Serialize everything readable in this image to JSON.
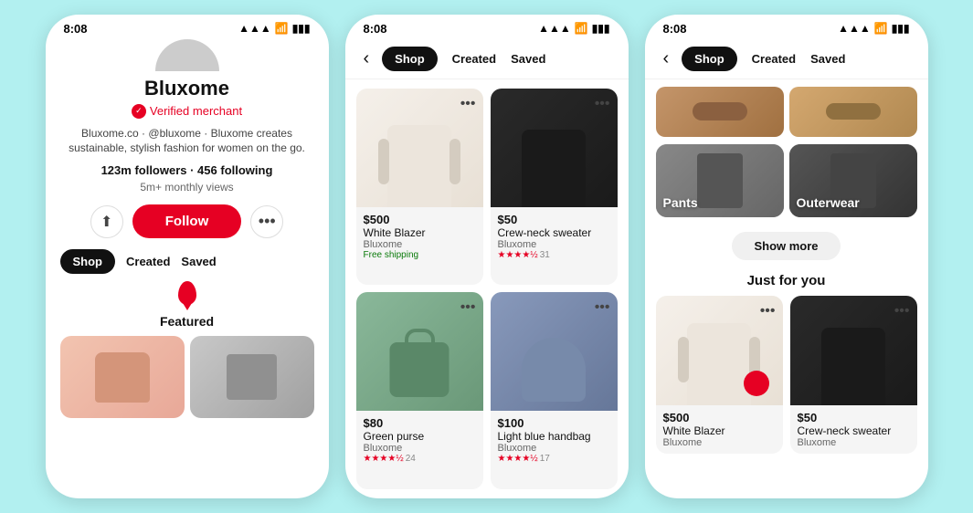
{
  "app": {
    "bg_color": "#b2f0f0"
  },
  "phone1": {
    "status_time": "8:08",
    "profile": {
      "name": "Bluxome",
      "verified_label": "Verified merchant",
      "bio": "Bluxome.co · @bluxome · Bluxome creates sustainable, stylish fashion for women on the go.",
      "followers": "123m followers · 456 following",
      "views": "5m+ monthly views",
      "follow_btn": "Follow",
      "tabs": [
        "Shop",
        "Created",
        "Saved"
      ],
      "active_tab": "Shop",
      "featured_label": "Featured"
    }
  },
  "phone2": {
    "status_time": "8:08",
    "nav": {
      "back": "‹",
      "tabs": [
        "Shop",
        "Created",
        "Saved"
      ],
      "active_tab": "Shop"
    },
    "products": [
      {
        "price": "$500",
        "name": "White Blazer",
        "brand": "Bluxome",
        "shipping": "Free shipping",
        "rating": null,
        "rating_count": null,
        "img_class": "img-white-blazer"
      },
      {
        "price": "$50",
        "name": "Crew-neck sweater",
        "brand": "Bluxome",
        "shipping": null,
        "rating": "★★★★½",
        "rating_count": "31",
        "img_class": "img-black-sweater-card"
      },
      {
        "price": "$80",
        "name": "Green purse",
        "brand": "Bluxome",
        "shipping": null,
        "rating": "★★★★½",
        "rating_count": "24",
        "img_class": "img-green-purse"
      },
      {
        "price": "$100",
        "name": "Light blue handbag",
        "brand": "Bluxome",
        "shipping": null,
        "rating": "★★★★½",
        "rating_count": "17",
        "img_class": "img-blue-bag"
      }
    ]
  },
  "phone3": {
    "status_time": "8:08",
    "nav": {
      "back": "‹",
      "tabs": [
        "Shop",
        "Created",
        "Saved"
      ],
      "active_tab": "Shop"
    },
    "categories": [
      {
        "label": "Pants",
        "img_class": "cat-pants"
      },
      {
        "label": "Outerwear",
        "img_class": "cat-outerwear"
      }
    ],
    "show_more_btn": "Show more",
    "just_for_you_label": "Just for you",
    "jfy_products": [
      {
        "price": "$500",
        "name": "White Blazer",
        "brand": "Bluxome",
        "img_class": "img-white-blazer-jfy",
        "has_red_dot": true
      },
      {
        "price": "$50",
        "name": "Crew-neck sweater",
        "brand": "Bluxome",
        "img_class": "img-black-sweater-jfy",
        "has_red_dot": false
      }
    ],
    "top_imgs": [
      "img-shoes-brown",
      "img-shoes-tan"
    ]
  }
}
